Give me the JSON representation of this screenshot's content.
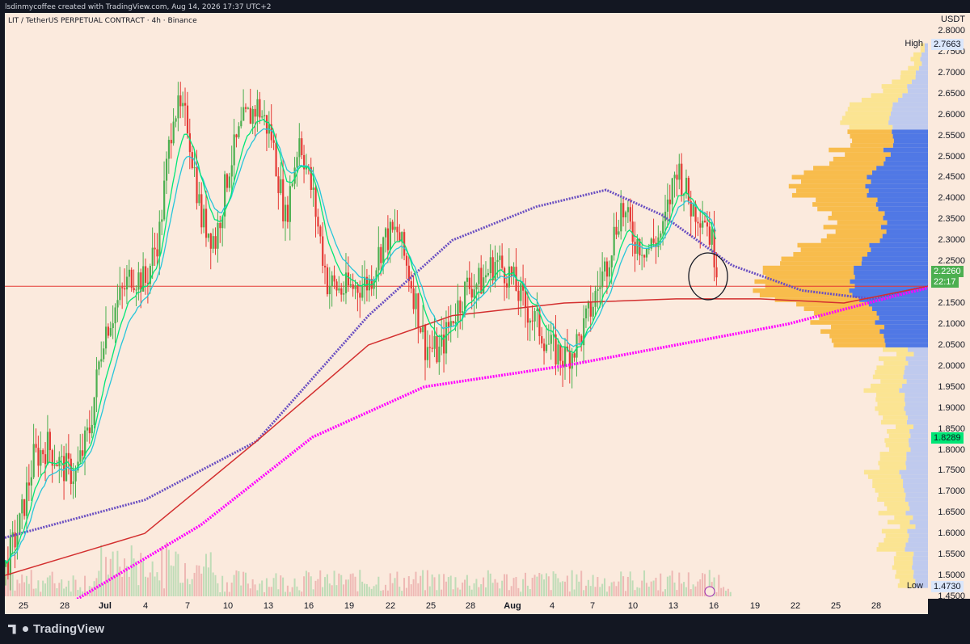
{
  "header": {
    "credit": "lsdinmycoffee created with TradingView.com, Aug 14, 2026 17:37 UTC+2",
    "symbol": "LIT / TetherUS PERPETUAL CONTRACT · 4h · Binance"
  },
  "footer": {
    "brand": "TradingView"
  },
  "price_axis": {
    "currency": "USDT",
    "ticks": [
      "2.8000",
      "2.7500",
      "2.7000",
      "2.6500",
      "2.6000",
      "2.5500",
      "2.5000",
      "2.4500",
      "2.4000",
      "2.3500",
      "2.3000",
      "2.2500",
      "2.1500",
      "2.1000",
      "2.0500",
      "2.0000",
      "1.9500",
      "1.9000",
      "1.8500",
      "1.8000",
      "1.7500",
      "1.7000",
      "1.6500",
      "1.6000",
      "1.5500",
      "1.5000",
      "1.4500"
    ],
    "high_label": "High",
    "high_value": "2.7663",
    "low_label": "Low",
    "low_value": "1.4730",
    "last_price": "2.2260",
    "countdown": "22:17",
    "green_level": "1.8289"
  },
  "time_axis": {
    "ticks": [
      "25",
      "28",
      "Jul",
      "4",
      "7",
      "10",
      "13",
      "16",
      "19",
      "22",
      "25",
      "28",
      "Aug",
      "4",
      "7",
      "10",
      "13",
      "16",
      "19",
      "22",
      "25",
      "28"
    ]
  },
  "colors": {
    "background": "#fbeadd",
    "up_candle": "#4caf50",
    "down_candle": "#e53935",
    "ema_fast": "#00e676",
    "ema_mid": "#26c6da",
    "sma_purple": "#6a4fc1",
    "ema_red": "#d32f2f",
    "sma_magenta": "#ff00ff",
    "hline": "#e53935",
    "vp_orange": "#f7b73c",
    "vp_blue": "#3d6ce6",
    "vp_light_yellow": "#fbe38a",
    "vp_light_blue": "#b8c6f0"
  },
  "chart_data": {
    "type": "candlestick",
    "timeframe": "4h",
    "ylim": [
      1.44,
      2.81
    ],
    "x_ticks": [
      "25",
      "28",
      "Jul",
      "4",
      "7",
      "10",
      "13",
      "16",
      "19",
      "22",
      "25",
      "28",
      "Aug",
      "4",
      "7",
      "10",
      "13",
      "16",
      "19",
      "22",
      "25",
      "28"
    ],
    "close_path": [
      [
        "Jun 24",
        1.52
      ],
      [
        "Jun 25",
        1.62
      ],
      [
        "Jun 26",
        1.78
      ],
      [
        "Jun 27",
        1.81
      ],
      [
        "Jun 28",
        1.76
      ],
      [
        "Jun 29",
        1.74
      ],
      [
        "Jun 30",
        1.85
      ],
      [
        "Jul 1",
        2.08
      ],
      [
        "Jul 2",
        2.15
      ],
      [
        "Jul 3",
        2.22
      ],
      [
        "Jul 4",
        2.2
      ],
      [
        "Jul 5",
        2.32
      ],
      [
        "Jul 6",
        2.62
      ],
      [
        "Jul 7",
        2.58
      ],
      [
        "Jul 8",
        2.35
      ],
      [
        "Jul 9",
        2.3
      ],
      [
        "Jul 10",
        2.48
      ],
      [
        "Jul 11",
        2.58
      ],
      [
        "Jul 12",
        2.62
      ],
      [
        "Jul 13",
        2.55
      ],
      [
        "Jul 14",
        2.35
      ],
      [
        "Jul 15",
        2.55
      ],
      [
        "Jul 16",
        2.4
      ],
      [
        "Jul 17",
        2.2
      ],
      [
        "Jul 18",
        2.18
      ],
      [
        "Jul 19",
        2.19
      ],
      [
        "Jul 20",
        2.2
      ],
      [
        "Jul 21",
        2.3
      ],
      [
        "Jul 22",
        2.32
      ],
      [
        "Jul 23",
        2.2
      ],
      [
        "Jul 24",
        2.05
      ],
      [
        "Jul 25",
        2.03
      ],
      [
        "Jul 26",
        2.12
      ],
      [
        "Jul 27",
        2.19
      ],
      [
        "Jul 28",
        2.2
      ],
      [
        "Jul 29",
        2.25
      ],
      [
        "Jul 30",
        2.22
      ],
      [
        "Jul 31",
        2.15
      ],
      [
        "Aug 1",
        2.1
      ],
      [
        "Aug 2",
        2.04
      ],
      [
        "Aug 3",
        2.02
      ],
      [
        "Aug 4",
        2.06
      ],
      [
        "Aug 5",
        2.15
      ],
      [
        "Aug 6",
        2.25
      ],
      [
        "Aug 7",
        2.38
      ],
      [
        "Aug 8",
        2.3
      ],
      [
        "Aug 9",
        2.28
      ],
      [
        "Aug 10",
        2.32
      ],
      [
        "Aug 11",
        2.48
      ],
      [
        "Aug 12",
        2.38
      ],
      [
        "Aug 13",
        2.36
      ],
      [
        "Aug 14",
        2.226
      ]
    ],
    "horizontal_line": 2.19,
    "price_label": 2.226,
    "high": 2.7663,
    "low": 1.473,
    "ema_fast": [
      [
        0,
        1.55
      ],
      [
        4,
        1.78
      ],
      [
        8,
        1.95
      ],
      [
        12,
        2.45
      ],
      [
        16,
        2.35
      ],
      [
        20,
        2.5
      ],
      [
        24,
        2.35
      ],
      [
        28,
        2.2
      ],
      [
        32,
        2.28
      ],
      [
        36,
        2.1
      ],
      [
        40,
        2.17
      ],
      [
        44,
        2.22
      ],
      [
        48,
        2.1
      ],
      [
        52,
        2.08
      ],
      [
        56,
        2.3
      ],
      [
        60,
        2.36
      ],
      [
        64,
        2.42
      ],
      [
        67,
        2.33
      ],
      [
        69,
        2.28
      ]
    ],
    "sma_purple": [
      [
        0,
        1.59
      ],
      [
        10,
        1.68
      ],
      [
        18,
        1.82
      ],
      [
        26,
        2.12
      ],
      [
        32,
        2.3
      ],
      [
        38,
        2.38
      ],
      [
        43,
        2.42
      ],
      [
        47,
        2.36
      ],
      [
        52,
        2.24
      ],
      [
        57,
        2.18
      ],
      [
        62,
        2.16
      ],
      [
        66,
        2.19
      ],
      [
        69,
        2.23
      ]
    ],
    "ema_red": [
      [
        0,
        1.5
      ],
      [
        10,
        1.6
      ],
      [
        18,
        1.82
      ],
      [
        26,
        2.05
      ],
      [
        32,
        2.12
      ],
      [
        40,
        2.15
      ],
      [
        48,
        2.16
      ],
      [
        54,
        2.16
      ],
      [
        60,
        2.15
      ],
      [
        66,
        2.19
      ],
      [
        69,
        2.22
      ]
    ],
    "sma_magenta": [
      [
        5,
        1.44
      ],
      [
        14,
        1.62
      ],
      [
        22,
        1.83
      ],
      [
        30,
        1.95
      ],
      [
        40,
        2.0
      ],
      [
        48,
        2.05
      ],
      [
        56,
        2.1
      ],
      [
        64,
        2.17
      ],
      [
        69,
        2.21
      ]
    ]
  }
}
